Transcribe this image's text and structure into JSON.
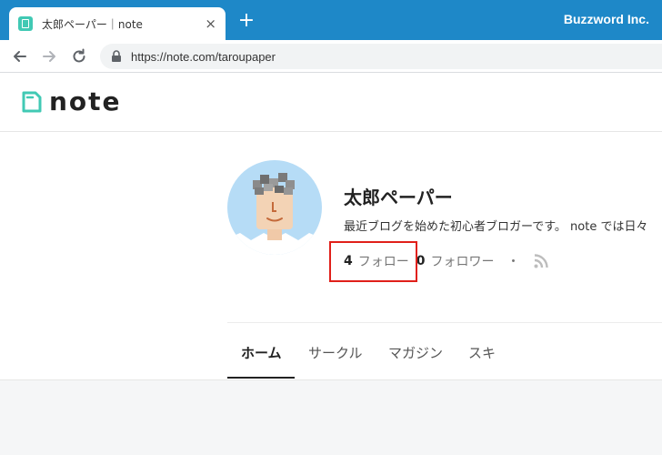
{
  "browser": {
    "tab_title": "太郎ペーパー｜note",
    "tab_close": "×",
    "new_tab": "+",
    "brand": "Buzzword Inc.",
    "url": "https://note.com/taroupaper"
  },
  "header": {
    "logo_text": "note",
    "accent_color": "#41c9b4"
  },
  "profile": {
    "name": "太郎ペーパー",
    "bio": "最近ブログを始めた初心者ブロガーです。 note では日々",
    "follow_count": "4",
    "follow_label": "フォロー",
    "follower_count": "0",
    "follower_label": "フォロワー",
    "separator": "・",
    "rss_icon": "rss-icon"
  },
  "tabs": [
    {
      "label": "ホーム",
      "active": true
    },
    {
      "label": "サークル",
      "active": false
    },
    {
      "label": "マガジン",
      "active": false
    },
    {
      "label": "スキ",
      "active": false
    }
  ],
  "colors": {
    "titlebar": "#1e88c8",
    "highlight": "#e0201a"
  }
}
